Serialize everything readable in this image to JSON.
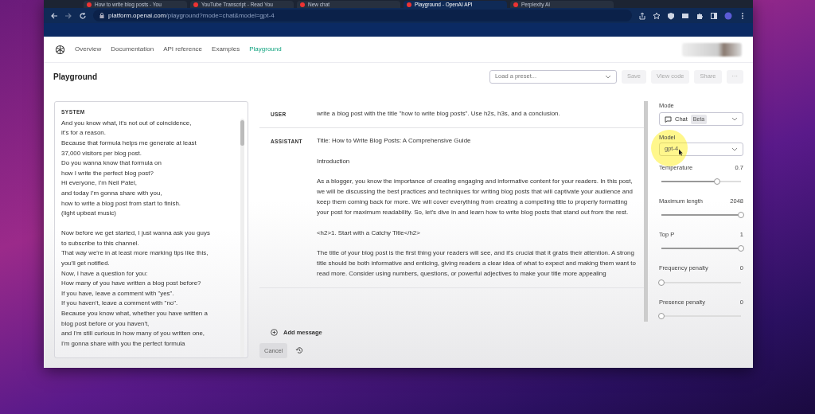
{
  "browser": {
    "tabs": [
      {
        "label": "How to write blog posts - You",
        "selected": false
      },
      {
        "label": "YouTube Transcript - Read You",
        "selected": false
      },
      {
        "label": "New chat",
        "selected": false
      },
      {
        "label": "Playground - OpenAI API",
        "selected": true
      },
      {
        "label": "Perplexity AI",
        "selected": false
      }
    ],
    "address_host": "platform.openai.com",
    "address_path": "/playground?mode=chat&model=gpt-4"
  },
  "nav": [
    {
      "label": "Overview",
      "selected": false
    },
    {
      "label": "Documentation",
      "selected": false
    },
    {
      "label": "API reference",
      "selected": false
    },
    {
      "label": "Examples",
      "selected": false
    },
    {
      "label": "Playground",
      "selected": true
    }
  ],
  "header": {
    "title": "Playground",
    "preset_placeholder": "Load a preset...",
    "buttons": [
      "Save",
      "View code",
      "Share",
      "···"
    ]
  },
  "system": {
    "label": "SYSTEM",
    "paragraphs": [
      [
        "And you know what, it's not out of coincidence,",
        "it's for a reason.",
        "Because that formula helps me generate at least",
        "37,000 visitors per blog post.",
        "Do you wanna know that formula on",
        "how I write the perfect blog post?",
        "Hi everyone, I'm Neil Patel,",
        "and today I'm gonna share with you,",
        "how to write a blog post from start to finish.",
        "(light upbeat music)"
      ],
      [
        "Now before we get started, I just wanna ask you guys",
        "to subscribe to this channel.",
        "That way we're in at least more marking tips like this,",
        "you'll get notified.",
        "Now, I have a question for you:",
        "How many of you have written a blog post before?",
        "If you have, leave a comment with \"yes\".",
        "If you haven't, leave a comment with \"no\".",
        "Because you know what, whether you have written a",
        "blog post before or you haven't,",
        "and I'm still curious in how many of you written one,",
        "I'm gonna share with you the perfect formula"
      ]
    ]
  },
  "messages": [
    {
      "role": "USER",
      "paragraphs": [
        "write a blog post with the title \"how to write blog posts\".  Use h2s, h3s, and a conclusion."
      ]
    },
    {
      "role": "ASSISTANT",
      "paragraphs": [
        "Title: How to Write Blog Posts: A Comprehensive Guide",
        "Introduction",
        "As a blogger, you know the importance of creating engaging and informative content for your readers. In this post, we will be discussing the best practices and techniques for writing blog posts that will captivate your audience and keep them coming back for more. We will cover everything from creating a compelling title to properly formatting your post for maximum readability. So, let's dive in and learn how to write blog posts that stand out from the rest.",
        "<h2>1. Start with a Catchy Title</h2>",
        "The title of your blog post is the first thing your readers will see, and it's crucial that it grabs their attention. A strong title should be both informative and enticing, giving readers a clear idea of what to expect and making them want to read more. Consider using numbers, questions, or powerful adjectives to make your title more appealing"
      ]
    }
  ],
  "add_message": "Add message",
  "cancel": "Cancel",
  "settings": {
    "mode": {
      "label": "Mode",
      "value": "Chat",
      "badge": "Beta"
    },
    "model": {
      "label": "Model",
      "value": "gpt-4"
    },
    "sliders": [
      {
        "label": "Temperature",
        "reading": "0.7",
        "level": 0.7
      },
      {
        "label": "Maximum length",
        "reading": "2048",
        "level": 1
      },
      {
        "label": "Top P",
        "reading": "1",
        "level": 1
      },
      {
        "label": "Frequency penalty",
        "reading": "0",
        "level": 0
      },
      {
        "label": "Presence penalty",
        "reading": "0",
        "level": 0
      }
    ]
  }
}
